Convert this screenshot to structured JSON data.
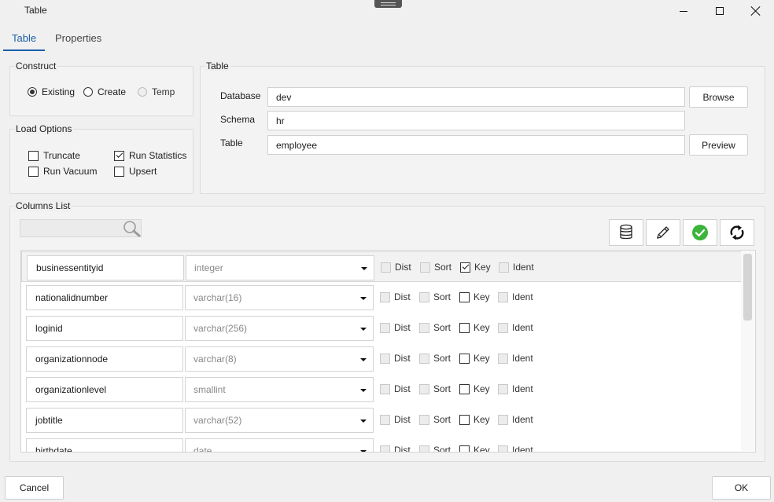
{
  "window": {
    "title": "Table"
  },
  "tabs": [
    {
      "label": "Table"
    },
    {
      "label": "Properties"
    }
  ],
  "construct": {
    "title": "Construct",
    "options": [
      {
        "label": "Existing",
        "selected": true
      },
      {
        "label": "Create",
        "selected": false
      },
      {
        "label": "Temp",
        "selected": false,
        "disabled": true
      }
    ]
  },
  "load_options": {
    "title": "Load Options",
    "items": [
      {
        "label": "Truncate",
        "checked": false
      },
      {
        "label": "Run Statistics",
        "checked": true
      },
      {
        "label": "Run Vacuum",
        "checked": false
      },
      {
        "label": "Upsert",
        "checked": false
      }
    ]
  },
  "table_group": {
    "title": "Table",
    "database_label": "Database",
    "database_value": "dev",
    "schema_label": "Schema",
    "schema_value": "hr",
    "table_label": "Table",
    "table_value": "employee",
    "browse_label": "Browse",
    "preview_label": "Preview"
  },
  "columns_list": {
    "title": "Columns List",
    "toolbar_icons": [
      "database-icon",
      "pencil-icon",
      "check-circle-icon",
      "refresh-icon"
    ],
    "flag_labels": {
      "dist": "Dist",
      "sort": "Sort",
      "key": "Key",
      "ident": "Ident"
    },
    "rows": [
      {
        "name": "businessentityid",
        "type": "integer",
        "key": true
      },
      {
        "name": "nationalidnumber",
        "type": "varchar(16)",
        "key": false
      },
      {
        "name": "loginid",
        "type": "varchar(256)",
        "key": false
      },
      {
        "name": "organizationnode",
        "type": "varchar(8)",
        "key": false
      },
      {
        "name": "organizationlevel",
        "type": "smallint",
        "key": false
      },
      {
        "name": "jobtitle",
        "type": "varchar(52)",
        "key": false
      },
      {
        "name": "birthdate",
        "type": "date",
        "key": false
      }
    ]
  },
  "footer": {
    "cancel_label": "Cancel",
    "ok_label": "OK"
  },
  "colors": {
    "accent": "#1a5fa8",
    "ok_green": "#3cb43c"
  }
}
